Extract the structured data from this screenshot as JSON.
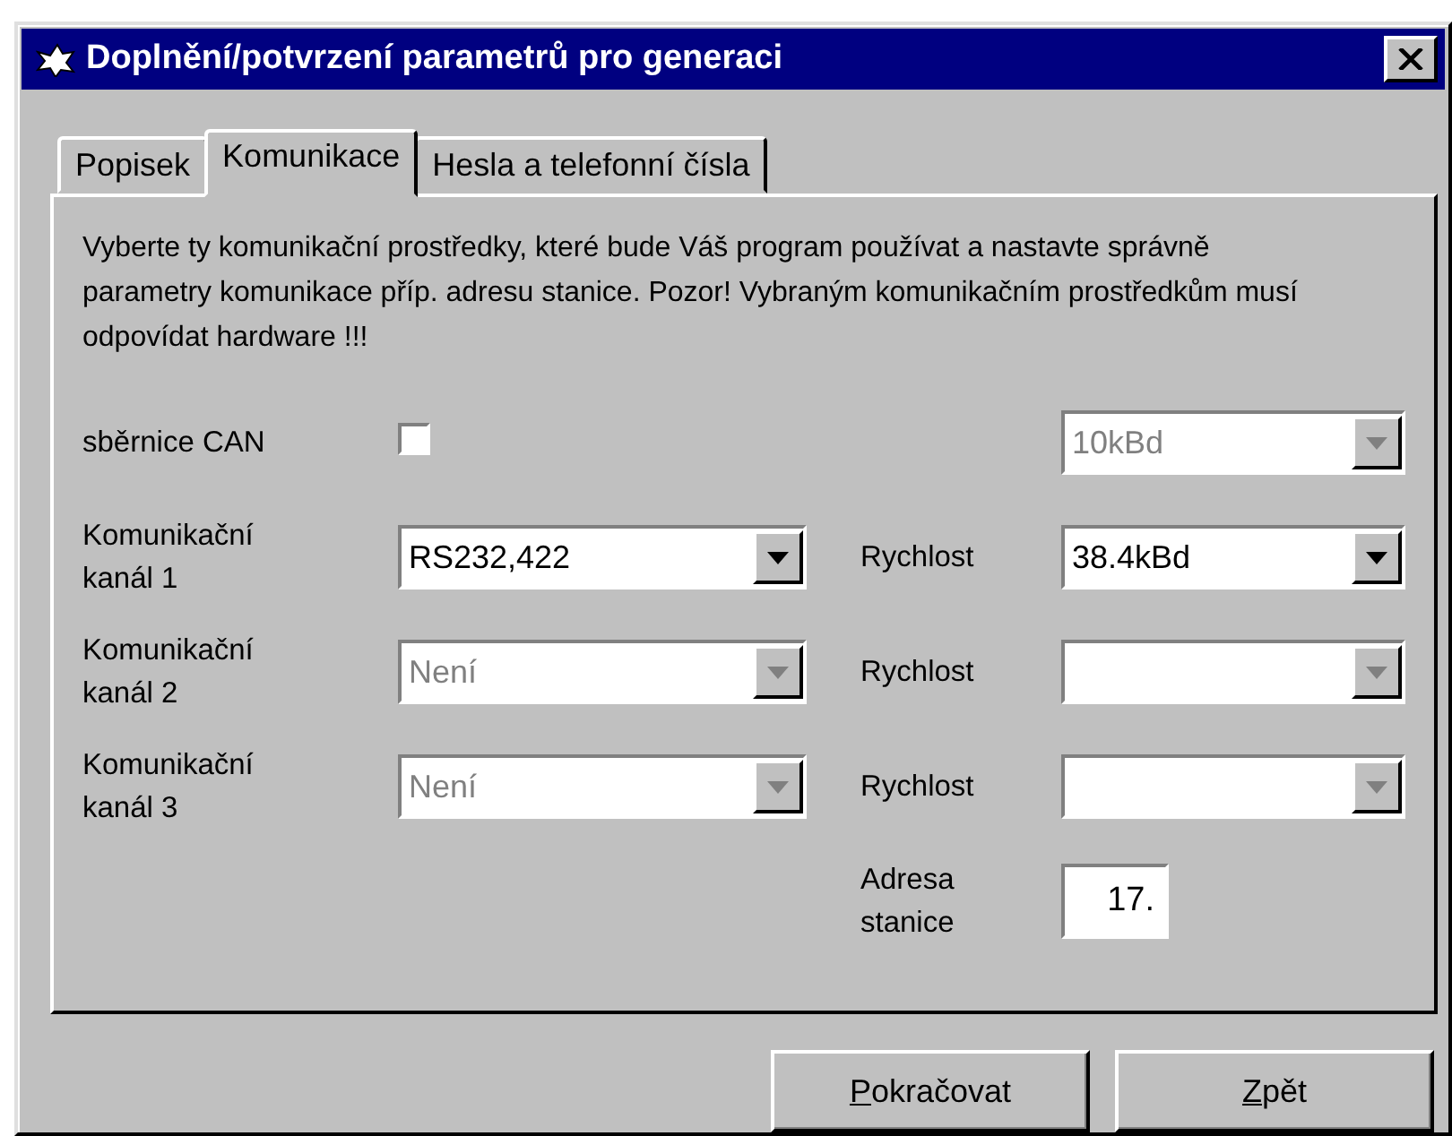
{
  "window": {
    "title": "Doplnění/potvrzení parametrů pro generaci"
  },
  "tabs": [
    {
      "label": "Popisek",
      "selected": false
    },
    {
      "label": "Komunikace",
      "selected": true
    },
    {
      "label": "Hesla a telefonní čísla",
      "selected": false
    }
  ],
  "description": "Vyberte ty komunikační prostředky, které bude Váš program používat a nastavte správně parametry komunikace příp. adresu stanice. Pozor! Vybraným komunikačním prostředkům musí odpovídat hardware !!!",
  "can_bus": {
    "label": "sběrnice CAN",
    "checked": false,
    "speed": {
      "value": "10kBd",
      "disabled": true
    }
  },
  "channels": [
    {
      "label": "Komunikační kanál 1",
      "port": {
        "value": "RS232,422",
        "disabled": false
      },
      "speed_label": "Rychlost",
      "speed": {
        "value": "38.4kBd",
        "disabled": false
      }
    },
    {
      "label": "Komunikační kanál 2",
      "port": {
        "value": "Není",
        "disabled": true
      },
      "speed_label": "Rychlost",
      "speed": {
        "disabled": true
      }
    },
    {
      "label": "Komunikační kanál 3",
      "port": {
        "value": "Není",
        "disabled": true
      },
      "speed_label": "Rychlost",
      "speed": {
        "disabled": true
      }
    }
  ],
  "address": {
    "label": "Adresa stanice",
    "value": "17."
  },
  "buttons": [
    {
      "label": "Pokračovat",
      "mnemonic_first": true
    },
    {
      "label": "Zpět",
      "mnemonic_first": true
    }
  ]
}
